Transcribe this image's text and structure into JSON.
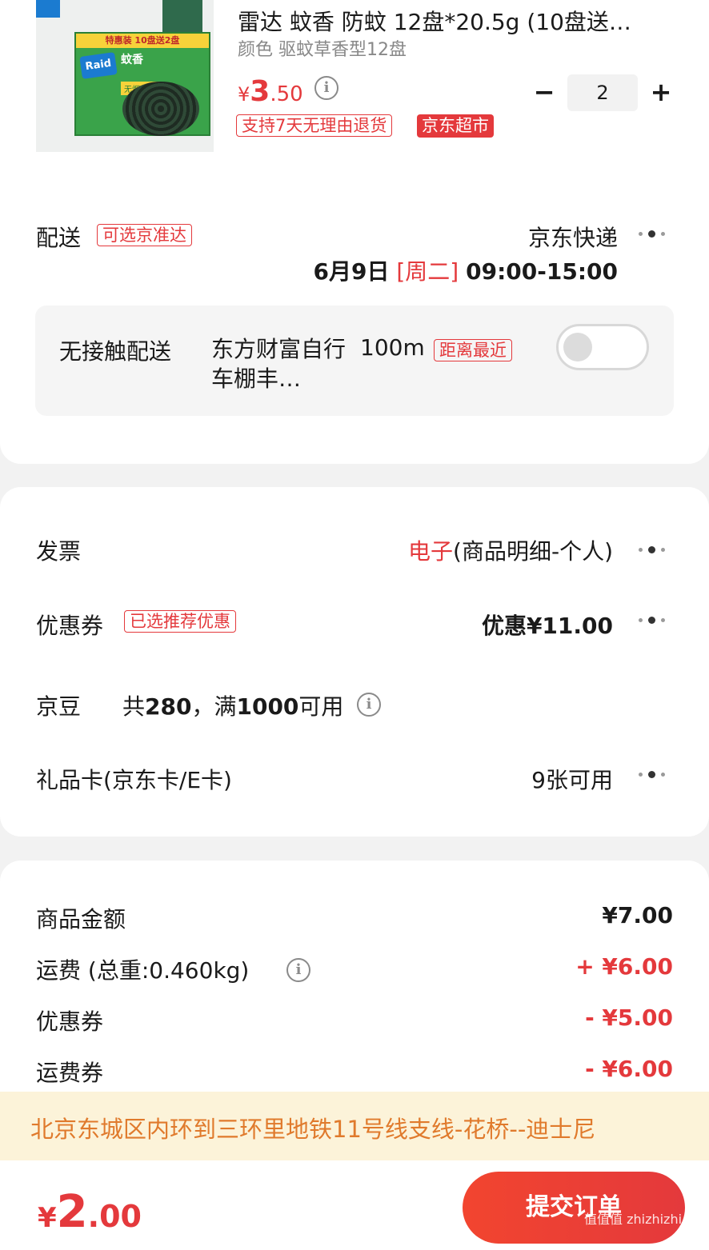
{
  "product": {
    "title": "雷达 蚊香 防蚊 12盘*20.5g (10盘送…",
    "variant": "颜色 驱蚊草香型12盘",
    "price_symbol": "¥",
    "price_int": "3",
    "price_dec": ".50",
    "qty": "2",
    "return_tag": "支持7天无理由退货",
    "store_tag": "京东超市",
    "image": {
      "brand": "Raid",
      "product_name": "蚊香",
      "promo": "特惠装 10盘送2盘",
      "sub_badge": "无烟 大盘"
    }
  },
  "delivery": {
    "label": "配送",
    "tag": "可选京准达",
    "carrier": "京东快递",
    "date": "6月9日",
    "weekday": "[周二]",
    "time": "09:00-15:00",
    "contactless": "无接触配送",
    "location": "东方财富自行车棚丰…",
    "distance": "100m",
    "nearest_tag": "距离最近",
    "toggle_on": false
  },
  "invoice": {
    "label": "发票",
    "value_red": "电子",
    "value_rest": "(商品明细-个人)"
  },
  "coupon": {
    "label": "优惠券",
    "tag": "已选推荐优惠",
    "value": "优惠¥11.00"
  },
  "jingdou": {
    "label": "京豆",
    "prefix": "共",
    "count": "280",
    "mid": "，满",
    "threshold": "1000",
    "suffix": "可用"
  },
  "giftcard": {
    "label": "礼品卡(京东卡/E卡)",
    "value": "9张可用"
  },
  "summary": [
    {
      "label": "商品金额",
      "value": "¥7.00",
      "color": "#1a1a1a"
    },
    {
      "label": "运费",
      "extra": "(总重:0.460kg)",
      "value": "+ ¥6.00",
      "color": "#e4393c"
    },
    {
      "label": "优惠券",
      "value": "- ¥5.00",
      "color": "#e4393c"
    },
    {
      "label": "运费券",
      "value": "- ¥6.00",
      "color": "#e4393c"
    }
  ],
  "address_bar": "北京东城区内环到三环里地铁11号线支线-花桥--迪士尼",
  "footer": {
    "total_symbol": "¥",
    "total_int": "2",
    "total_dec": ".00",
    "submit_label": "提交订单",
    "watermark": "值值值 zhizhizhi.com"
  },
  "colors": {
    "accent": "#e4393c",
    "address_bg": "#fcf3d9",
    "address_text": "#e07a2c"
  }
}
